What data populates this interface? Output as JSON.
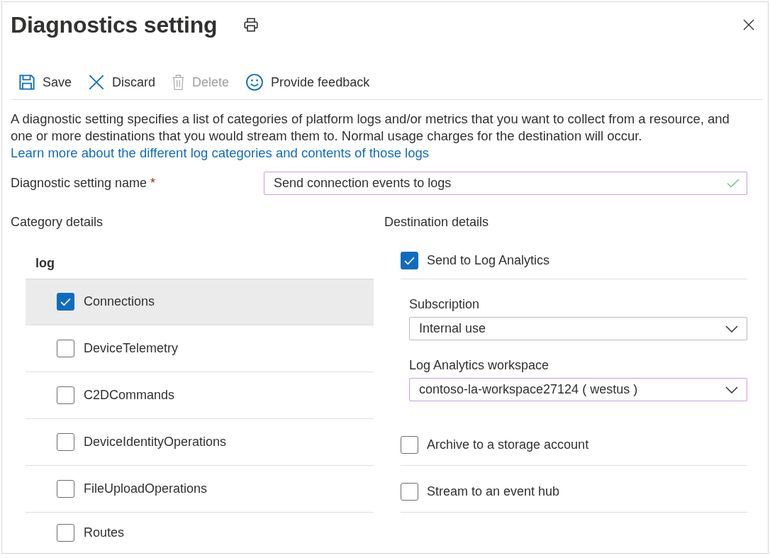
{
  "panel": {
    "title": "Diagnostics setting"
  },
  "toolbar": [
    {
      "kind": "save",
      "label": "Save",
      "disabled": false
    },
    {
      "kind": "discard",
      "label": "Discard",
      "disabled": false
    },
    {
      "kind": "delete",
      "label": "Delete",
      "disabled": true
    },
    {
      "kind": "feedback",
      "label": "Provide feedback",
      "disabled": false
    }
  ],
  "description": {
    "text": "A diagnostic setting specifies a list of categories of platform logs and/or metrics that you want to collect from a resource, and one or more destinations that you would stream them to. Normal usage charges for the destination will occur.",
    "link": "Learn more about the different log categories and contents of those logs"
  },
  "name_field": {
    "label": "Diagnostic setting name",
    "required_mark": "*",
    "value": "Send connection events to logs",
    "valid": true,
    "focused": true
  },
  "category_details": {
    "heading": "Category details",
    "group_label": "log",
    "items": [
      {
        "label": "Connections",
        "checked": true,
        "selected": true
      },
      {
        "label": "DeviceTelemetry",
        "checked": false,
        "selected": false
      },
      {
        "label": "C2DCommands",
        "checked": false,
        "selected": false
      },
      {
        "label": "DeviceIdentityOperations",
        "checked": false,
        "selected": false
      },
      {
        "label": "FileUploadOperations",
        "checked": false,
        "selected": false
      },
      {
        "label": "Routes",
        "checked": false,
        "selected": false
      }
    ]
  },
  "destination_details": {
    "heading": "Destination details",
    "options": [
      {
        "label": "Send to Log Analytics",
        "checked": true,
        "fields": [
          {
            "label": "Subscription",
            "value": "Internal use",
            "focused": false
          },
          {
            "label": "Log Analytics workspace",
            "value": "contoso-la-workspace27124 ( westus )",
            "focused": true
          }
        ]
      },
      {
        "label": "Archive to a storage account",
        "checked": false
      },
      {
        "label": "Stream to an event hub",
        "checked": false
      }
    ]
  }
}
